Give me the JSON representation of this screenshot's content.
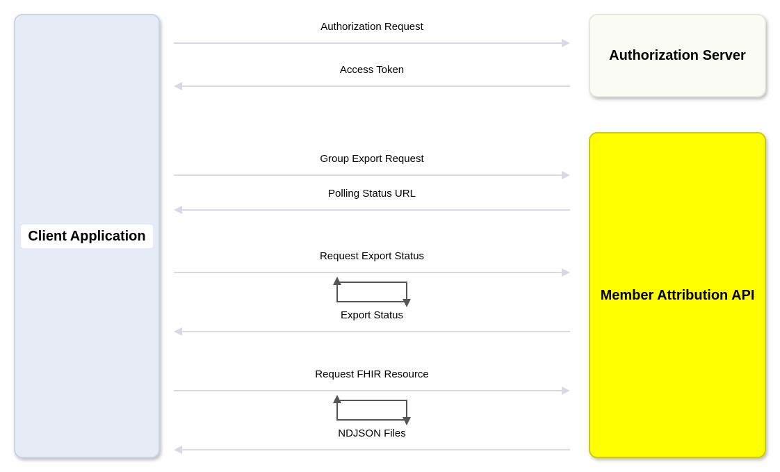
{
  "nodes": {
    "client": "Client Application",
    "auth_server": "Authorization Server",
    "member_api": "Member Attribution API"
  },
  "messages": {
    "auth_request": "Authorization Request",
    "access_token": "Access Token",
    "group_export": "Group Export Request",
    "polling_url": "Polling Status URL",
    "req_export_status": "Request Export Status",
    "export_status": "Export Status",
    "req_fhir": "Request FHIR Resource",
    "ndjson": "NDJSON Files"
  }
}
